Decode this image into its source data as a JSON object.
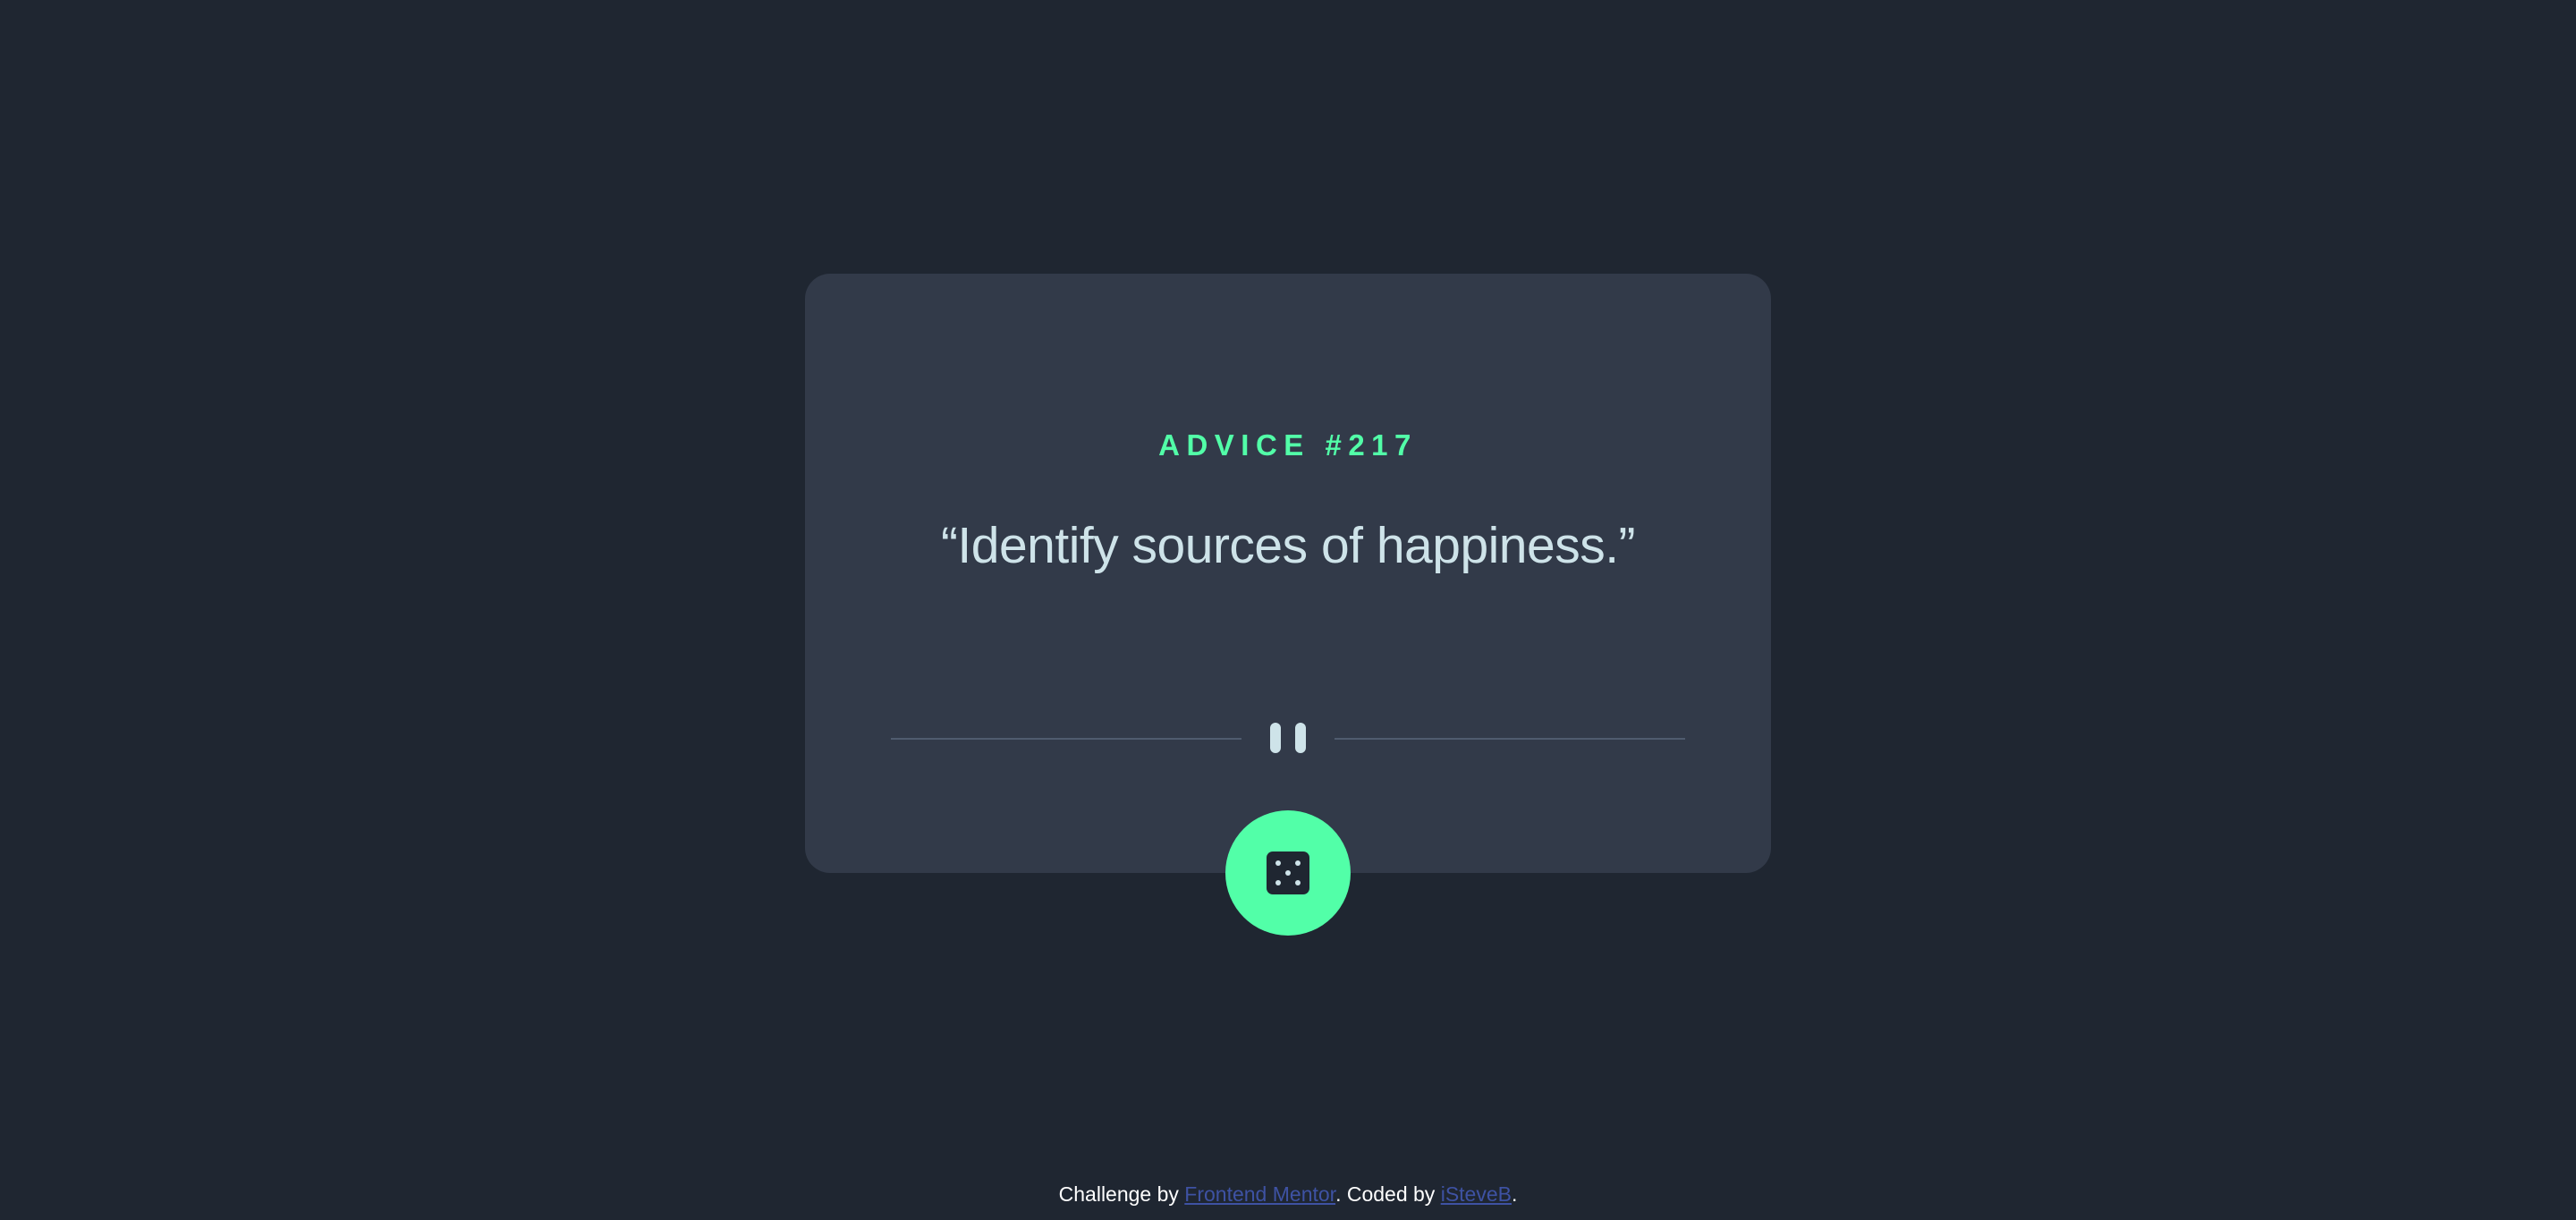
{
  "card": {
    "advice_label": "ADVICE #217",
    "advice_text": "“Identify sources of happiness.”",
    "divider_icon": "pause-icon",
    "dice_button": {
      "icon": "dice-icon",
      "color": "#52ffa8"
    }
  },
  "footer": {
    "prefix": "Challenge by ",
    "link1_label": "Frontend Mentor",
    "middle": ". Coded by ",
    "link2_label": "iSteveB",
    "suffix": "."
  },
  "colors": {
    "background": "#1f2631",
    "card": "#323a49",
    "accent": "#52ffa8",
    "text": "#cee3e9",
    "link": "#3e52a3"
  }
}
